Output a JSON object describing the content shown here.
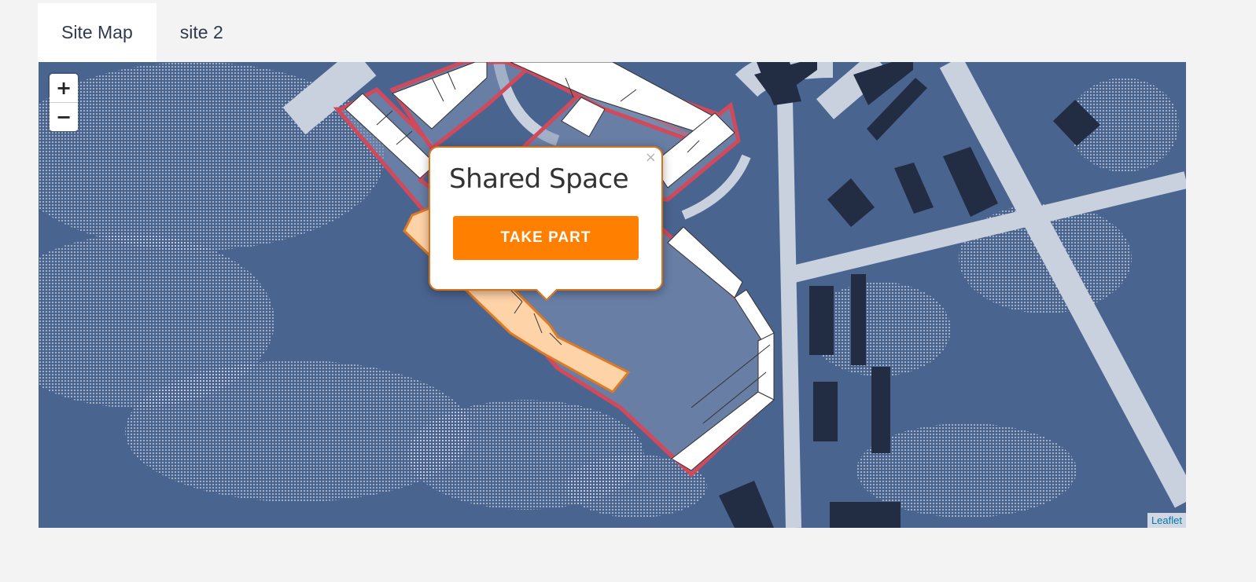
{
  "tabs": [
    {
      "label": "Site Map",
      "active": true
    },
    {
      "label": "site 2",
      "active": false
    }
  ],
  "map": {
    "zoom_in_label": "+",
    "zoom_out_label": "−",
    "attribution": "Leaflet"
  },
  "popup": {
    "title": "Shared Space",
    "button_label": "TAKE PART",
    "close_label": "×"
  },
  "colors": {
    "map_background": "#4a6490",
    "roads": "#c9d1df",
    "dark_buildings": "#222d44",
    "site_outline": "#d04a5c",
    "highlight_fill": "#ffd3a8",
    "highlight_outline": "#e07a22",
    "accent_button": "#ff7f00"
  }
}
